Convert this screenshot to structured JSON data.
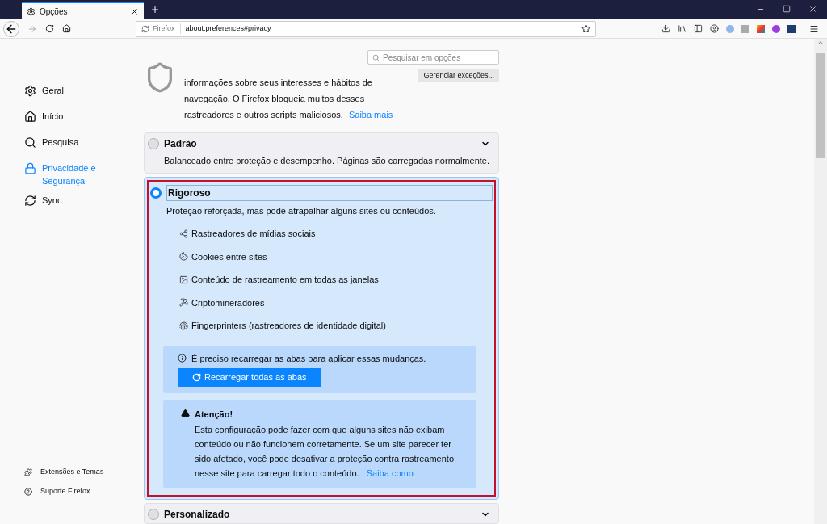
{
  "tab": {
    "title": "Opções"
  },
  "url_bar": {
    "identity": "Firefox",
    "url": "about:preferences#privacy"
  },
  "search": {
    "placeholder": "Pesquisar em opções"
  },
  "sidebar": {
    "items": [
      {
        "label": "Geral",
        "kind": "gear",
        "selected": false
      },
      {
        "label": "Início",
        "kind": "home",
        "selected": false
      },
      {
        "label": "Pesquisa",
        "kind": "search",
        "selected": false
      },
      {
        "label": "Privacidade e Segurança",
        "kind": "lock",
        "selected": true
      },
      {
        "label": "Sync",
        "kind": "sync",
        "selected": false
      }
    ],
    "footer": [
      {
        "label": "Extensões e Temas",
        "kind": "puzzle"
      },
      {
        "label": "Suporte Firefox",
        "kind": "help"
      }
    ]
  },
  "tracking": {
    "description": "informações sobre seus interesses e hábitos de navegação. O Firefox bloqueia muitos desses rastreadores e outros scripts maliciosos.",
    "link": "Saiba mais",
    "manage_button": "Gerenciar exceções..."
  },
  "options": [
    {
      "label": "Padrão",
      "description": "Balanceado entre proteção e desempenho. Páginas são carregadas normalmente.",
      "selected": false,
      "expanded": false
    },
    {
      "label": "Rigoroso",
      "description": "Proteção reforçada, mas pode atrapalhar alguns sites ou conteúdos.",
      "selected": true,
      "expanded": true,
      "categories": [
        {
          "label": "Rastreadores de mídias sociais",
          "kind": "social"
        },
        {
          "label": "Cookies entre sites",
          "kind": "cookie"
        },
        {
          "label": "Conteúdo de rastreamento em todas as janelas",
          "kind": "image"
        },
        {
          "label": "Criptomineradores",
          "kind": "miner"
        },
        {
          "label": "Fingerprinters (rastreadores de identidade digital)",
          "kind": "fingerprint"
        }
      ],
      "reload_notice": "É preciso recarregar as abas para aplicar essas mudanças.",
      "reload_button": "Recarregar todas as abas",
      "warning_title": "Atenção!",
      "warning_text": "Esta configuração pode fazer com que alguns sites não exibam conteúdo ou não funcionem corretamente. Se um site parecer ter sido afetado, você pode desativar a proteção contra rastreamento nesse site para carregar todo o conteúdo.",
      "warning_link": "Saiba como"
    },
    {
      "label": "Personalizado",
      "selected": false,
      "expanded": false
    }
  ]
}
